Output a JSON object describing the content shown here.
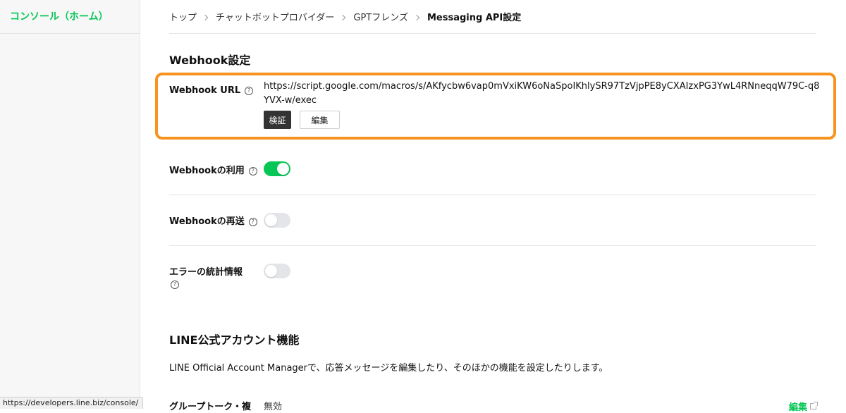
{
  "sidebar": {
    "home_label": "コンソール（ホーム）"
  },
  "breadcrumb": {
    "items": [
      "トップ",
      "チャットボットプロバイダー",
      "GPTフレンズ",
      "Messaging API設定"
    ]
  },
  "webhook_section": {
    "title": "Webhook設定",
    "url_label": "Webhook URL",
    "url_value": "https://script.google.com/macros/s/AKfycbw6vap0mVxiKW6oNaSpoIKhlySR97TzVjpPE8yCXAIzxPG3YwL4RNneqqW79C-q8YVX-w/exec",
    "verify_button": "検証",
    "edit_button": "編集",
    "use_webhook": {
      "label": "Webhookの利用",
      "enabled": true
    },
    "redelivery": {
      "label": "Webhookの再送",
      "enabled": false
    },
    "error_stats": {
      "label": "エラーの統計情報",
      "enabled": false
    },
    "help_glyph": "?"
  },
  "oa_section": {
    "title": "LINE公式アカウント機能",
    "description": "LINE Official Account Managerで、応答メッセージを編集したり、そのほかの機能を設定したりします。",
    "group_chat": {
      "label": "グループトーク・複",
      "value": "無効",
      "edit_link": "編集"
    }
  },
  "status_bar": {
    "url": "https://developers.line.biz/console/"
  },
  "colors": {
    "accent_green": "#06c755",
    "highlight_orange": "#f7931e",
    "dark_button": "#333333"
  }
}
